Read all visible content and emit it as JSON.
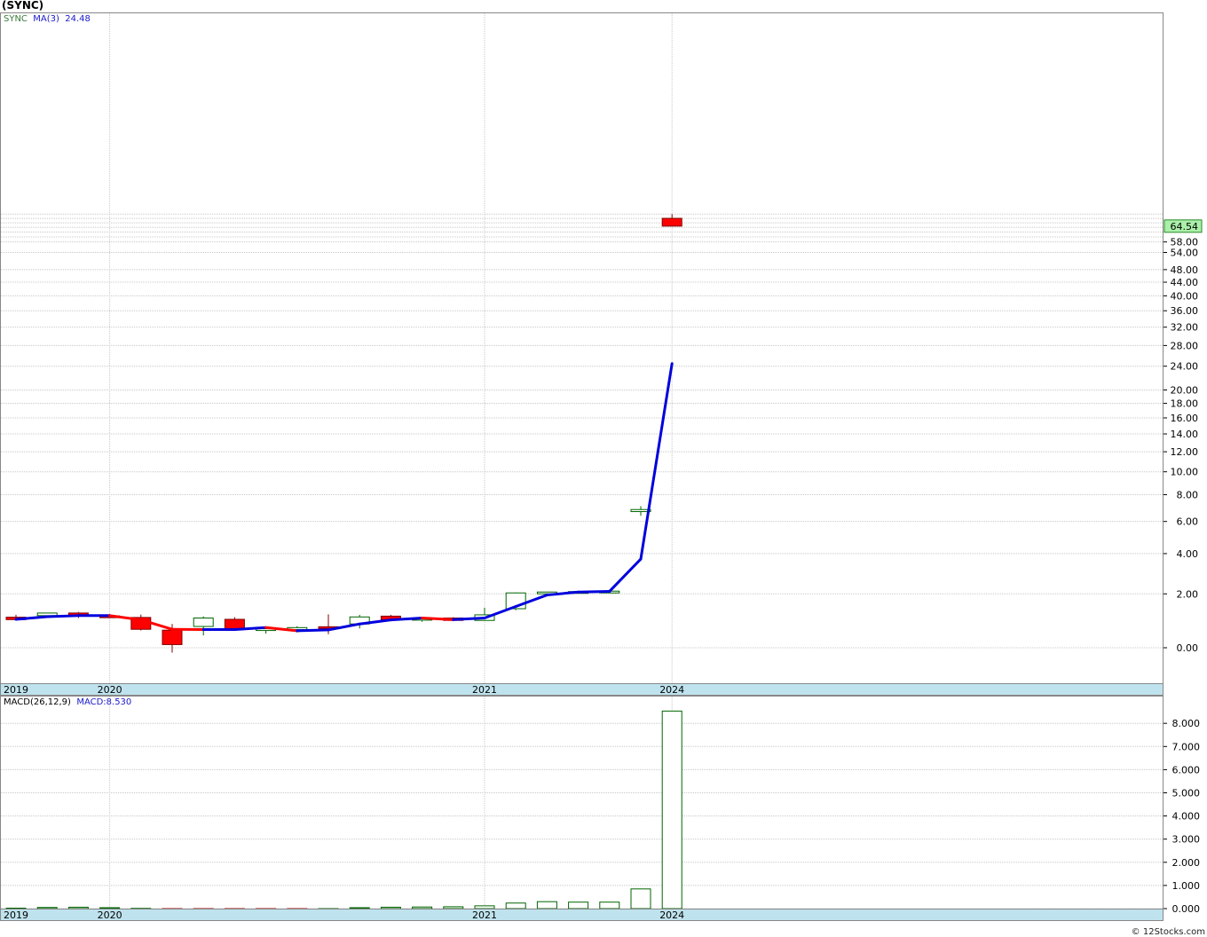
{
  "header": {
    "title": "(SYNC)"
  },
  "legend": {
    "symbol": "SYNC",
    "ma_label": "MA(3)",
    "ma_value": "24.48",
    "macd_label": "MACD(26,12,9)",
    "macd_value": "MACD:8.530"
  },
  "last_price_label": "64.54",
  "footer": {
    "credit": "© 12Stocks.com"
  },
  "colors": {
    "up_candle": "#006400",
    "down_candle": "#ff0000",
    "ma_up": "#0000dd",
    "ma_down": "#ff0000",
    "axis_band": "#bfe3ee",
    "price_tag": "#aaf0aa"
  },
  "chart_data": [
    {
      "type": "candlestick",
      "title": "(SYNC)",
      "y_scale": "log-offset",
      "y_ticks": [
        "0.00",
        "2.00",
        "4.00",
        "6.00",
        "8.00",
        "10.00",
        "12.00",
        "14.00",
        "16.00",
        "18.00",
        "20.00",
        "24.00",
        "28.00",
        "32.00",
        "36.00",
        "40.00",
        "44.00",
        "48.00",
        "54.00",
        "58.00"
      ],
      "x_labels": [
        "2019",
        "2020",
        "2021",
        "2024"
      ],
      "series": [
        {
          "name": "SYNC",
          "candles": [
            {
              "o": 1.05,
              "h": 1.14,
              "l": 0.93,
              "c": 0.96
            },
            {
              "o": 1.11,
              "h": 1.22,
              "l": 1.07,
              "c": 1.21
            },
            {
              "o": 1.21,
              "h": 1.25,
              "l": 1.02,
              "c": 1.1
            },
            {
              "o": 1.1,
              "h": 1.17,
              "l": 1.06,
              "c": 1.07
            },
            {
              "o": 1.04,
              "h": 1.15,
              "l": 0.57,
              "c": 0.61
            },
            {
              "o": 0.58,
              "h": 0.8,
              "l": -0.15,
              "c": 0.1
            },
            {
              "o": 0.71,
              "h": 1.08,
              "l": 0.4,
              "c": 1.02
            },
            {
              "o": 0.97,
              "h": 1.05,
              "l": 0.57,
              "c": 0.6
            },
            {
              "o": 0.6,
              "h": 0.68,
              "l": 0.46,
              "c": 0.63
            },
            {
              "o": 0.6,
              "h": 0.72,
              "l": 0.5,
              "c": 0.67
            },
            {
              "o": 0.7,
              "h": 1.16,
              "l": 0.44,
              "c": 0.68
            },
            {
              "o": 0.8,
              "h": 1.14,
              "l": 0.64,
              "c": 1.06
            },
            {
              "o": 1.09,
              "h": 1.14,
              "l": 0.93,
              "c": 0.96
            },
            {
              "o": 0.94,
              "h": 1.05,
              "l": 0.88,
              "c": 1.02
            },
            {
              "o": 1.02,
              "h": 1.05,
              "l": 0.91,
              "c": 0.93
            },
            {
              "o": 0.93,
              "h": 1.42,
              "l": 0.91,
              "c": 1.14
            },
            {
              "o": 1.38,
              "h": 2.06,
              "l": 1.32,
              "c": 2.04
            },
            {
              "o": 2.07,
              "h": 2.09,
              "l": 2.01,
              "c": 2.08
            },
            {
              "o": 2.1,
              "h": 2.11,
              "l": 2.09,
              "c": 2.1
            },
            {
              "o": 2.12,
              "h": 2.13,
              "l": 2.11,
              "c": 2.12
            },
            {
              "o": 6.7,
              "h": 7.1,
              "l": 6.4,
              "c": 6.85
            },
            {
              "o": 68.0,
              "h": 70.0,
              "l": 64.54,
              "c": 64.54
            }
          ]
        },
        {
          "name": "MA(3)",
          "values": [
            0.97,
            1.07,
            1.11,
            1.11,
            0.95,
            0.61,
            0.6,
            0.6,
            0.67,
            0.56,
            0.59,
            0.8,
            0.95,
            1.02,
            0.96,
            1.02,
            1.47,
            1.95,
            2.08,
            2.11,
            3.7,
            24.48
          ]
        }
      ],
      "last_value": 64.54
    },
    {
      "type": "bar",
      "title": "MACD(26,12,9)",
      "y_ticks": [
        "0.000",
        "1.000",
        "2.000",
        "3.000",
        "4.000",
        "5.000",
        "6.000",
        "7.000",
        "8.000"
      ],
      "ylim": [
        0,
        8.6
      ],
      "x_labels": [
        "2019",
        "2020",
        "2021",
        "2024"
      ],
      "series": [
        {
          "name": "MACD",
          "values": [
            0.02,
            0.05,
            0.06,
            0.04,
            0.01,
            -0.03,
            -0.02,
            -0.03,
            -0.02,
            -0.01,
            0.0,
            0.04,
            0.06,
            0.07,
            0.08,
            0.12,
            0.24,
            0.3,
            0.28,
            0.28,
            0.85,
            8.53
          ]
        }
      ]
    }
  ]
}
